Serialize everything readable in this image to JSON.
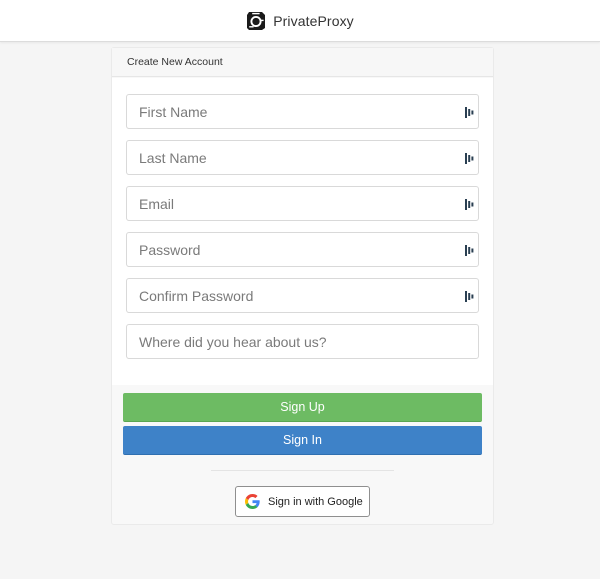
{
  "header": {
    "brand_name": "PrivateProxy",
    "logo_icon": "privateproxy-logo-icon"
  },
  "form": {
    "title": "Create New Account",
    "fields": [
      {
        "name": "first-name",
        "placeholder": "First Name",
        "value": "",
        "icon": "password-manager-icon"
      },
      {
        "name": "last-name",
        "placeholder": "Last Name",
        "value": "",
        "icon": "password-manager-icon"
      },
      {
        "name": "email",
        "placeholder": "Email",
        "value": "",
        "icon": "password-manager-icon"
      },
      {
        "name": "password",
        "placeholder": "Password",
        "value": "",
        "icon": "password-manager-icon"
      },
      {
        "name": "confirm-password",
        "placeholder": "Confirm Password",
        "value": "",
        "icon": "password-manager-icon"
      },
      {
        "name": "referral",
        "placeholder": "Where did you hear about us?",
        "value": ""
      }
    ],
    "signup_label": "Sign Up",
    "signin_label": "Sign In",
    "google_label": "Sign in with Google",
    "google_icon": "google-icon"
  },
  "colors": {
    "signup": "#6dbb63",
    "signin": "#3e82c8",
    "background": "#f5f5f5"
  }
}
